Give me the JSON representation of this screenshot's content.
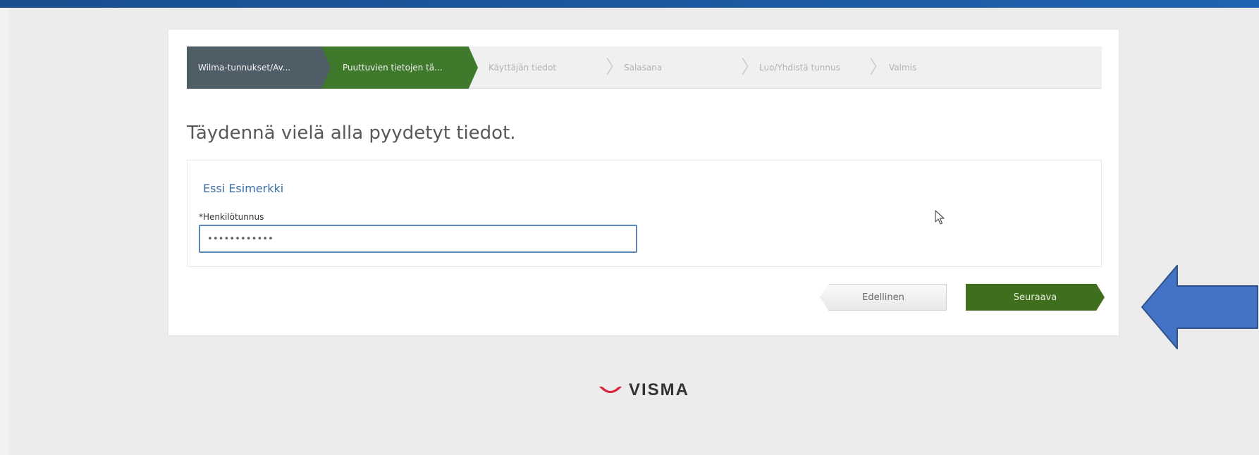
{
  "wizard": {
    "steps": [
      {
        "label": "Wilma-tunnukset/Av...",
        "state": "done"
      },
      {
        "label": "Puuttuvien tietojen tä...",
        "state": "active"
      },
      {
        "label": "Käyttäjän tiedot",
        "state": "pending"
      },
      {
        "label": "Salasana",
        "state": "pending"
      },
      {
        "label": "Luo/Yhdistä tunnus",
        "state": "pending"
      },
      {
        "label": "Valmis",
        "state": "pending"
      }
    ]
  },
  "page": {
    "heading": "Täydennä vielä alla pyydetyt tiedot."
  },
  "form": {
    "person_name": "Essi Esimerkki",
    "field_label": "*Henkilötunnus",
    "field_value": "••••••••••••"
  },
  "buttons": {
    "previous": "Edellinen",
    "next": "Seuraava"
  },
  "footer": {
    "logo_text": "VISMA"
  },
  "colors": {
    "top_bar": "#1c5aa1",
    "step_done": "#4f5e66",
    "step_active": "#3f7a2c",
    "next_button": "#3f6e1f",
    "annotation_arrow": "#4472c4",
    "logo_mark": "#d7263d"
  },
  "icons": {
    "cursor": "mouse-pointer-icon",
    "annotation": "left-arrow-icon",
    "logo": "visma-logo-icon"
  }
}
